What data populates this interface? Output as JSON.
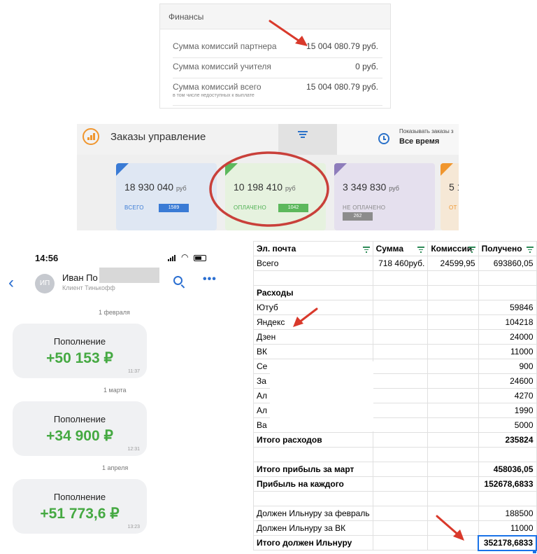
{
  "finance": {
    "header": "Финансы",
    "rows": [
      {
        "label": "Сумма комиссий партнера",
        "value": "15 004 080.79 руб."
      },
      {
        "label": "Сумма комиссий учителя",
        "value": "0 руб."
      },
      {
        "label": "Сумма комиссий всего",
        "value": "15 004 080.79 руб.",
        "sub": "в том числе недоступных к выплате"
      }
    ]
  },
  "orders": {
    "title": "Заказы управление",
    "period_label": "Показывать заказы з",
    "period_value": "Все время",
    "cards": [
      {
        "amount": "18 930 040",
        "currency": "руб",
        "label": "ВСЕГО",
        "count": "1589"
      },
      {
        "amount": "10 198 410",
        "currency": "руб",
        "label": "ОПЛАЧЕНО",
        "count": "1042"
      },
      {
        "amount": "3 349 830",
        "currency": "руб",
        "label": "НЕ ОПЛАЧЕНО",
        "count": "262"
      },
      {
        "amount": "5 1",
        "currency": "",
        "label": "ОТ",
        "count": ""
      }
    ],
    "colors": {
      "blue": "#3a7bd5",
      "green": "#5cb85c",
      "purple": "#8e7dbb",
      "orange": "#f0962e"
    }
  },
  "phone": {
    "time": "14:56",
    "contact_name": "Иван По",
    "contact_sub": "Клиент Тинькофф",
    "avatar": "ИП",
    "messages": [
      {
        "date": "1 февраля",
        "label": "Пополнение",
        "amount": "+50 153 ₽",
        "time": "11:37"
      },
      {
        "date": "1 марта",
        "label": "Пополнение",
        "amount": "+34 900 ₽",
        "time": "12:31"
      },
      {
        "date": "1 апреля",
        "label": "Пополнение",
        "amount": "+51 773,6 ₽",
        "time": "13:23"
      }
    ],
    "accent": "#45a942"
  },
  "sheet": {
    "headers": [
      "Эл. почта",
      "Сумма",
      "Комиссии",
      "Получено"
    ],
    "rows": [
      {
        "cells": [
          "Всего",
          "718 460руб.",
          "24599,95",
          "693860,05"
        ],
        "bold": false
      },
      {
        "cells": [
          "",
          "",
          "",
          ""
        ],
        "bold": false
      },
      {
        "cells": [
          "Расходы",
          "",
          "",
          ""
        ],
        "bold": true
      },
      {
        "cells": [
          "Ютуб",
          "",
          "",
          "59846"
        ],
        "bold": false
      },
      {
        "cells": [
          "Яндекс",
          "",
          "",
          "104218"
        ],
        "bold": false
      },
      {
        "cells": [
          "Дзен",
          "",
          "",
          "24000"
        ],
        "bold": false
      },
      {
        "cells": [
          "ВК",
          "",
          "",
          "11000"
        ],
        "bold": false
      },
      {
        "cells": [
          "Се",
          "",
          "",
          "900"
        ],
        "bold": false
      },
      {
        "cells": [
          "За",
          "",
          "",
          "24600"
        ],
        "bold": false
      },
      {
        "cells": [
          "Ал",
          "",
          "",
          "4270"
        ],
        "bold": false
      },
      {
        "cells": [
          "Ал",
          "",
          "",
          "1990"
        ],
        "bold": false
      },
      {
        "cells": [
          "Ва",
          "",
          "",
          "5000"
        ],
        "bold": false
      },
      {
        "cells": [
          "Итого расходов",
          "",
          "",
          "235824"
        ],
        "bold": true
      },
      {
        "cells": [
          "",
          "",
          "",
          ""
        ],
        "bold": false
      },
      {
        "cells": [
          "Итого прибыль за март",
          "",
          "",
          "458036,05"
        ],
        "bold": true
      },
      {
        "cells": [
          "Прибыль на каждого",
          "",
          "",
          "152678,6833"
        ],
        "bold": true
      },
      {
        "cells": [
          "",
          "",
          "",
          ""
        ],
        "bold": false
      },
      {
        "cells": [
          "Должен Ильнуру за февраль",
          "",
          "",
          "188500"
        ],
        "bold": false
      },
      {
        "cells": [
          "Должен Ильнуру за ВК",
          "",
          "",
          "11000"
        ],
        "bold": false
      },
      {
        "cells": [
          "Итого должен Ильнуру",
          "",
          "",
          "352178,6833"
        ],
        "bold": true
      }
    ]
  },
  "annotation_color": "#d9392b"
}
